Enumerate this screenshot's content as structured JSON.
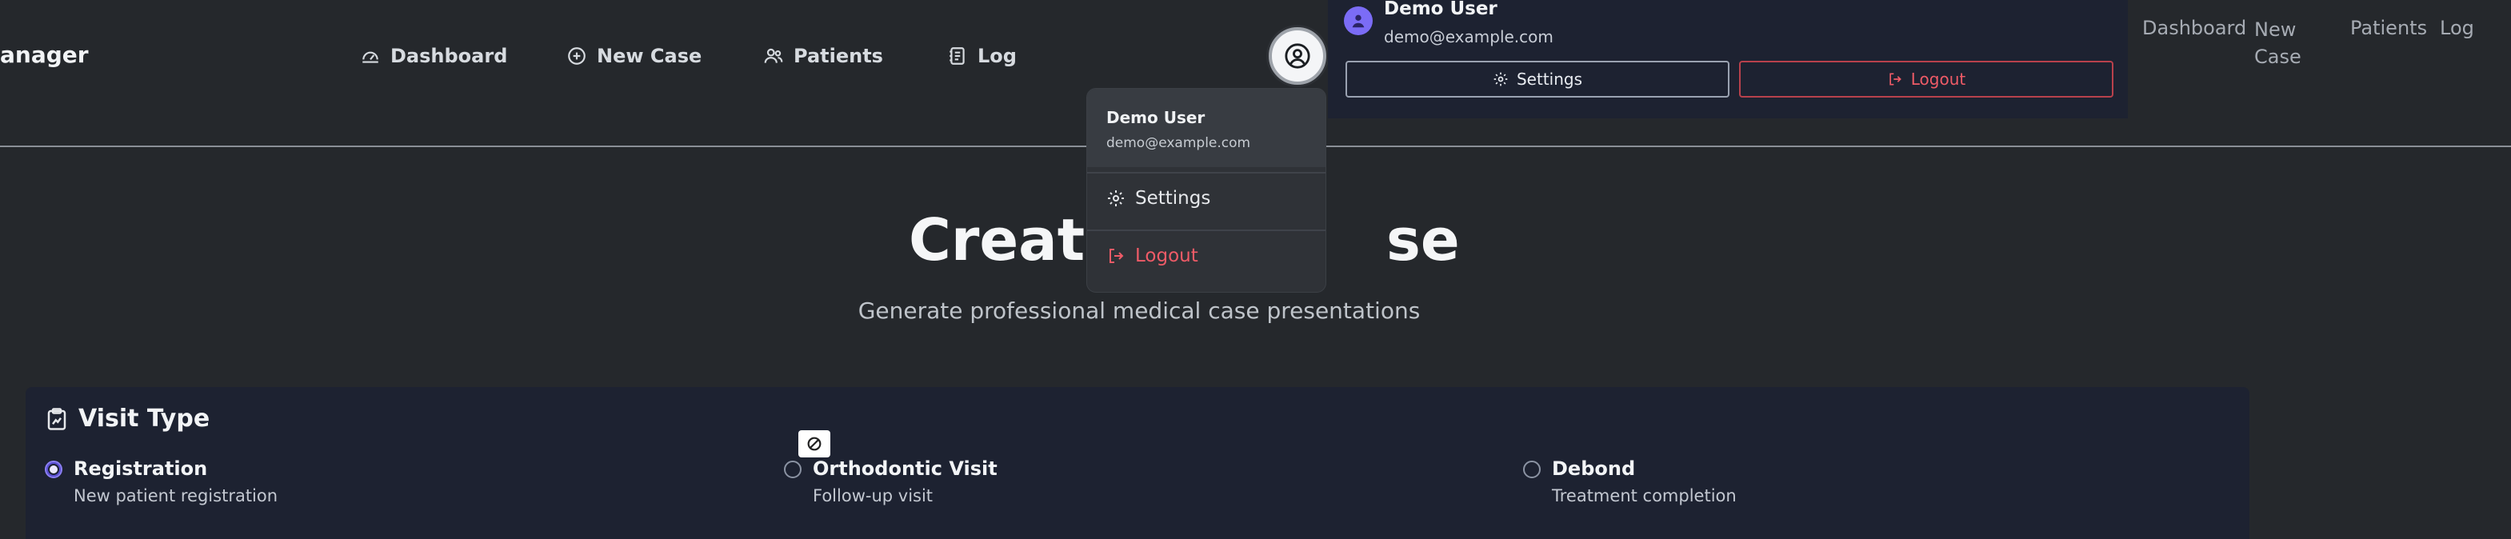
{
  "header": {
    "brand": "anager",
    "nav": [
      {
        "label": "Dashboard",
        "icon": "gauge-icon"
      },
      {
        "label": "New Case",
        "icon": "plus-circle-icon"
      },
      {
        "label": "Patients",
        "icon": "users-icon"
      },
      {
        "label": "Log",
        "icon": "notebook-icon"
      }
    ]
  },
  "user_menu": {
    "name": "Demo User",
    "email": "demo@example.com",
    "settings_label": "Settings",
    "logout_label": "Logout"
  },
  "mobile_panel": {
    "name": "Demo User",
    "email": "demo@example.com",
    "settings_label": "Settings",
    "logout_label": "Logout",
    "nav": [
      "Dashboard",
      "New\nCase",
      "Patients",
      "Log"
    ]
  },
  "hero": {
    "title_left": "Create",
    "title_right": "se",
    "subtitle": "Generate professional medical case presentations"
  },
  "visit_type": {
    "title": "Visit Type",
    "options": [
      {
        "label": "Registration",
        "description": "New patient registration",
        "selected": true
      },
      {
        "label": "Orthodontic Visit",
        "description": "Follow-up visit",
        "selected": false
      },
      {
        "label": "Debond",
        "description": "Treatment completion",
        "selected": false
      }
    ]
  },
  "colors": {
    "background": "#25282c",
    "card": "#1d2231",
    "accent": "#7b6cf6",
    "danger": "#ef5b67"
  }
}
